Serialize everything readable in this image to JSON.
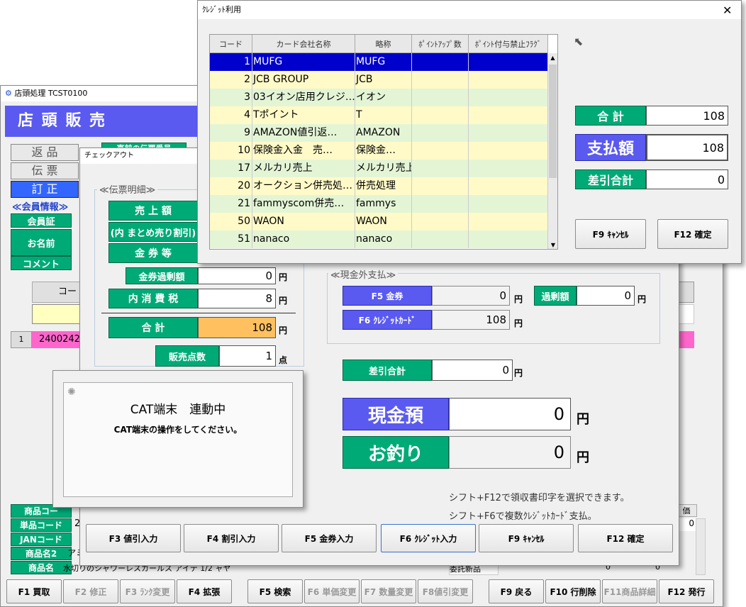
{
  "main_window": {
    "title": "店頭処理 TCST0100",
    "header": "店 頭 販 売",
    "side_buttons": [
      "返 品",
      "伝 票",
      "訂 正"
    ],
    "member_section": "≪会員情報≫",
    "member_labels": [
      "会員証",
      "お名前",
      "コメント"
    ],
    "prev_slip": "直前の伝票番号",
    "code_label": "コード",
    "row_number": "1",
    "row_code": "2400242",
    "product_labels": [
      "商品コー",
      "単品コード",
      "JANコード",
      "商品名2",
      "商品名"
    ],
    "product_values": [
      "",
      "2",
      "",
      "アミ",
      "水切りのシャワーレスカールス アイテ 1/2 ャヤ"
    ],
    "list_header": "価",
    "list_value": "0",
    "consign_label": "委託新品",
    "bottom_value": "0",
    "fkeys": [
      {
        "label": "F1 買取",
        "enabled": true
      },
      {
        "label": "F2 修正",
        "enabled": false
      },
      {
        "label": "F3 ﾗﾝｸ変更",
        "enabled": false
      },
      {
        "label": "F4 拡張",
        "enabled": true
      },
      {
        "label": "F5 検索",
        "enabled": true
      },
      {
        "label": "F6 単価変更",
        "enabled": false
      },
      {
        "label": "F7 数量変更",
        "enabled": false
      },
      {
        "label": "F8値引変更",
        "enabled": false
      },
      {
        "label": "F9 戻る",
        "enabled": true
      },
      {
        "label": "F10 行削除",
        "enabled": true
      },
      {
        "label": "F11商品詳細",
        "enabled": false
      },
      {
        "label": "F12 発行",
        "enabled": true
      }
    ]
  },
  "checkout": {
    "title": "チェックアウト",
    "slip_section": "≪伝票明細≫",
    "sales_amount": "売 上 額",
    "bundle_discount": "(内 まとめ売り割引)",
    "voucher": "金 券 等",
    "voucher_excess": "金券過剰額",
    "voucher_excess_value": "0",
    "tax": "内 消 費 税",
    "tax_value": "8",
    "total": "合  計",
    "total_value": "108",
    "qty": "販売点数",
    "qty_value": "1",
    "unit_yen": "円",
    "unit_pt": "点",
    "noncash_section": "≪現金外支払≫",
    "f5_voucher": "F5 金券",
    "f5_value": "0",
    "excess": "過剰額",
    "excess_value": "0",
    "f6_credit": "F6 ｸﾚｼﾞｯﾄｶｰﾄﾞ",
    "f6_value": "108",
    "diff_total": "差引合計",
    "diff_value": "0",
    "cash_received": "現金預",
    "cash_value": "0",
    "change": "お釣り",
    "change_value": "0",
    "hint1": "シフト+F12で領収書印字を選択できます。",
    "hint2": "シフト+F6で複数ｸﾚｼﾞｯﾄｶｰﾄﾞ支払。",
    "buttons": [
      "F3 値引入力",
      "F4 割引入力",
      "F5 金券入力",
      "F6 ｸﾚｼﾞｯﾄ入力",
      "F9 ｷｬﾝｾﾙ",
      "F12 確定"
    ]
  },
  "cat_dialog": {
    "title": "CAT端末　連動中",
    "message": "CAT端末の操作をしてください。"
  },
  "credit": {
    "title": "ｸﾚｼﾞｯﾄ利用",
    "close": "✕",
    "columns": [
      "コード",
      "カード会社名称",
      "略称",
      "ﾎﾟｲﾝﾄｱｯﾌﾟ数",
      "ﾎﾟｲﾝﾄ付与禁止ﾌﾗｸﾞ"
    ],
    "rows": [
      {
        "code": "1",
        "name": "MUFG",
        "abbr": "MUFG"
      },
      {
        "code": "2",
        "name": "JCB GROUP",
        "abbr": "JCB"
      },
      {
        "code": "3",
        "name": "03イオン店用クレジ…",
        "abbr": "イオン"
      },
      {
        "code": "4",
        "name": "Tポイント",
        "abbr": "T"
      },
      {
        "code": "9",
        "name": "AMAZON値引返…",
        "abbr": "AMAZON"
      },
      {
        "code": "10",
        "name": "保険金入金　売…",
        "abbr": "保険金…"
      },
      {
        "code": "17",
        "name": "メルカリ売上",
        "abbr": "メルカリ売上"
      },
      {
        "code": "20",
        "name": "オークション併売処…",
        "abbr": "併売処理"
      },
      {
        "code": "21",
        "name": "fammyscom併売…",
        "abbr": "fammys"
      },
      {
        "code": "50",
        "name": "WAON",
        "abbr": "WAON"
      },
      {
        "code": "51",
        "name": "nanaco",
        "abbr": "nanaco"
      }
    ],
    "total_label": "合  計",
    "total_value": "108",
    "pay_label": "支払額",
    "pay_value": "108",
    "diff_label": "差引合計",
    "diff_value": "0",
    "cancel": "F9 ｷｬﾝｾﾙ",
    "confirm": "F12 確定"
  },
  "colors": {
    "green": "#00aa77",
    "blue": "#5a5af0",
    "selected_row": "#0000cc",
    "row_yellow": "#fffac8",
    "row_green": "#e4f5d6",
    "orange": "#ffc060"
  }
}
